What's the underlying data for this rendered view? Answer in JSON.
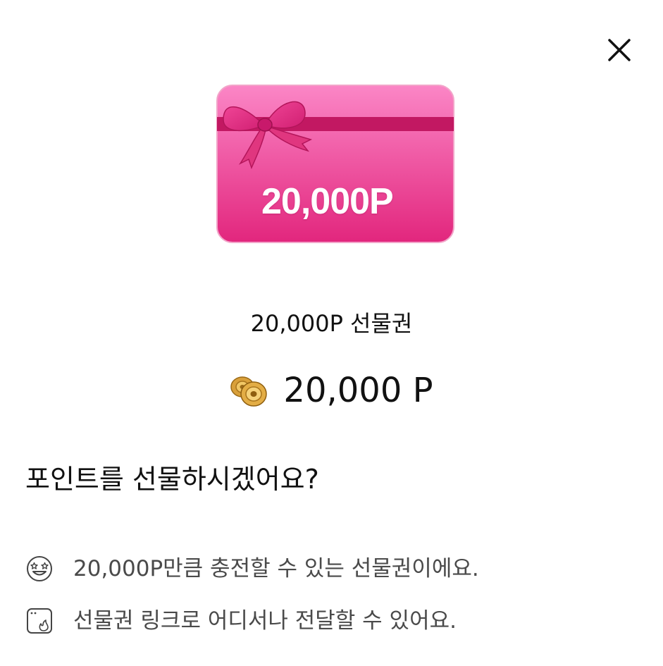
{
  "dialog": {
    "close_icon": "close-icon"
  },
  "card": {
    "amount_label": "20,000P",
    "colors": {
      "pink_light": "#f97cc0",
      "pink_dark": "#e4287f",
      "ribbon": "#c2185f"
    }
  },
  "product": {
    "name": "20,000P 선물권"
  },
  "price": {
    "icon": "coin-stack-icon",
    "value": "20,000 P"
  },
  "question": "포인트를 선물하시겠어요?",
  "info": [
    {
      "icon": "star-eyes-emoji-icon",
      "text": "20,000P만큼 충전할 수 있는 선물권이에요."
    },
    {
      "icon": "window-fire-icon",
      "text": "선물권 링크로 어디서나 전달할 수 있어요."
    }
  ]
}
